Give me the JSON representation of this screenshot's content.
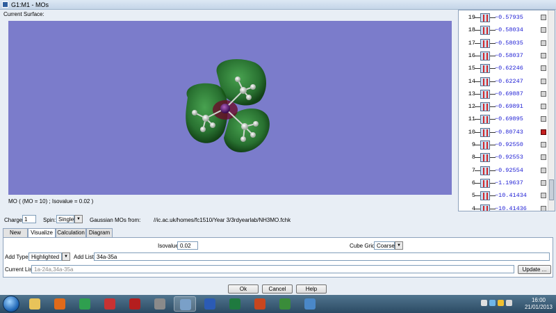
{
  "window": {
    "title": "G1:M1 - MOs"
  },
  "current_surface_label": "Current Surface:",
  "mo_readout": "MO ( (MO = 10) ; Isovalue = 0.02 )",
  "orbitals": [
    {
      "num": "19",
      "energy": "−0.57935",
      "selected": false
    },
    {
      "num": "18",
      "energy": "−0.58034",
      "selected": false
    },
    {
      "num": "17",
      "energy": "−0.58035",
      "selected": false
    },
    {
      "num": "16",
      "energy": "−0.58037",
      "selected": false
    },
    {
      "num": "15",
      "energy": "−0.62246",
      "selected": false
    },
    {
      "num": "14",
      "energy": "−0.62247",
      "selected": false
    },
    {
      "num": "13",
      "energy": "−0.69887",
      "selected": false
    },
    {
      "num": "12",
      "energy": "−0.69891",
      "selected": false
    },
    {
      "num": "11",
      "energy": "−0.69895",
      "selected": false
    },
    {
      "num": "10",
      "energy": "−0.80743",
      "selected": true
    },
    {
      "num": "9",
      "energy": "−0.92550",
      "selected": false
    },
    {
      "num": "8",
      "energy": "−0.92553",
      "selected": false
    },
    {
      "num": "7",
      "energy": "−0.92554",
      "selected": false
    },
    {
      "num": "6",
      "energy": "−1.19637",
      "selected": false
    },
    {
      "num": "5",
      "energy": "−10.41434",
      "selected": false
    },
    {
      "num": "4",
      "energy": "−10.41436",
      "selected": false
    }
  ],
  "charge": {
    "label": "Charge:",
    "value": "1"
  },
  "spin": {
    "label": "Spin:",
    "value": "Singlet"
  },
  "source": {
    "label": "Gaussian MOs from:",
    "path": "//ic.ac.uk/homes/fc1510/Year 3/3rdyearlab/NH3MO.fchk"
  },
  "tabs": [
    {
      "label": "New MOs",
      "active": false
    },
    {
      "label": "Visualize",
      "active": true
    },
    {
      "label": "Calculation",
      "active": false
    },
    {
      "label": "Diagram",
      "active": false
    }
  ],
  "visualize": {
    "isovalue_label": "Isovalue:",
    "isovalue": "0.02",
    "cube_grid_label": "Cube Grid:",
    "cube_grid": "Coarse",
    "add_type_label": "Add Type:",
    "add_type": "Highlighted",
    "add_list_label": "Add List:",
    "add_list": "34a-35a",
    "current_list_label": "Current List:",
    "current_list": "1a-24a,34a-35a",
    "update_label": "Update ..."
  },
  "buttons": {
    "ok": "Ok",
    "cancel": "Cancel",
    "help": "Help"
  },
  "taskbar": {
    "time": "16:00",
    "date": "21/01/2013",
    "apps": [
      "explorer-icon",
      "media-player-icon",
      "chrome-icon",
      "mathematica-icon",
      "acrobat-icon",
      "pdf-reader-icon",
      "gaussview-icon",
      "word-icon",
      "excel-icon",
      "powerpoint-icon",
      "chemdraw-icon",
      "paint-icon"
    ]
  },
  "colors": {
    "viewport_bg": "#7b7ccb",
    "orbital_green": "#1e7d1e",
    "selected_check": "#c42020",
    "energy_text": "#1c1cd4"
  }
}
